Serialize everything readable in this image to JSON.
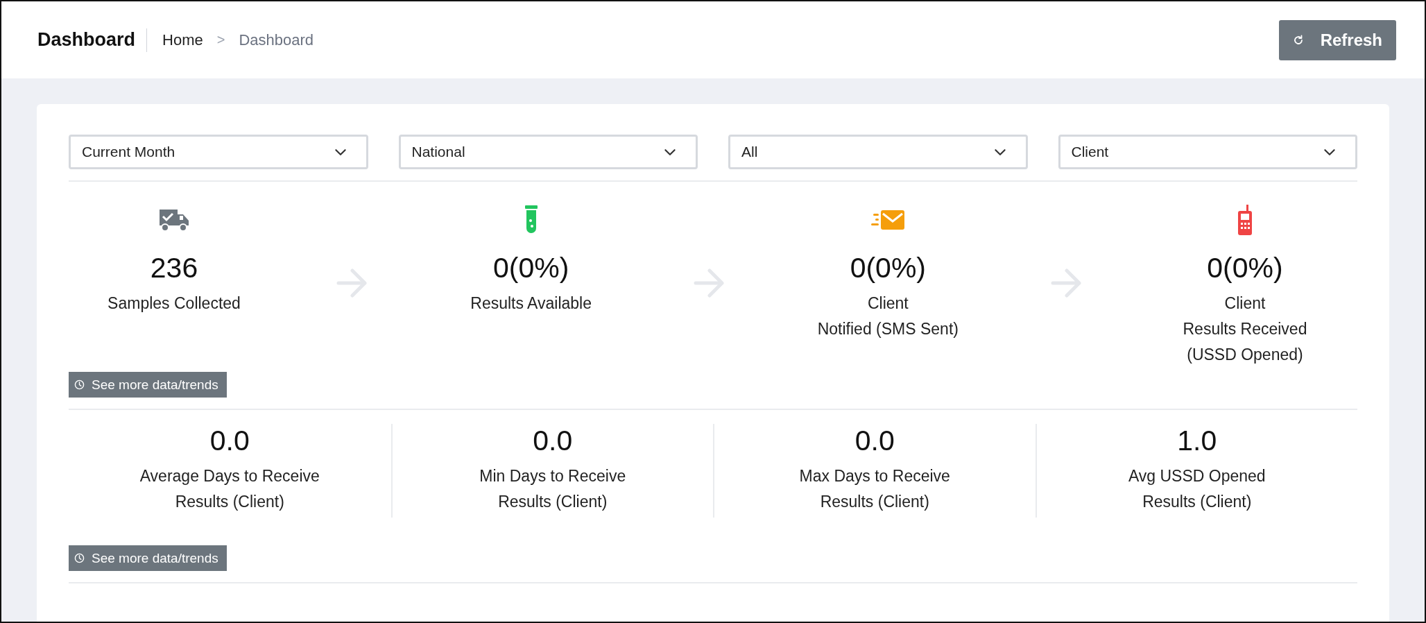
{
  "header": {
    "title": "Dashboard",
    "breadcrumb": [
      {
        "label": "Home"
      },
      {
        "label": "Dashboard"
      }
    ],
    "separator": ">",
    "refresh_button": "Refresh"
  },
  "filters": [
    {
      "value": "Current Month"
    },
    {
      "value": "National"
    },
    {
      "value": "All"
    },
    {
      "value": "Client"
    }
  ],
  "stages": [
    {
      "value": "236",
      "label": [
        "Samples Collected"
      ],
      "color": "#6c757d"
    },
    {
      "value": "0(0%)",
      "label": [
        "Results Available"
      ],
      "color": "#22c55e"
    },
    {
      "value": "0(0%)",
      "label": [
        "Client",
        "Notified (SMS Sent)"
      ],
      "color": "#f59e0b"
    },
    {
      "value": "0(0%)",
      "label": [
        "Client",
        "Results Received",
        "(USSD Opened)"
      ],
      "color": "#ef4444"
    }
  ],
  "stages_link": "See more data/trends",
  "stats": [
    {
      "value": "0.0",
      "label": [
        "Average Days to Receive",
        "Results (Client)"
      ]
    },
    {
      "value": "0.0",
      "label": [
        "Min Days to Receive",
        "Results (Client)"
      ]
    },
    {
      "value": "0.0",
      "label": [
        "Max Days to Receive",
        "Results (Client)"
      ]
    },
    {
      "value": "1.0",
      "label": [
        "Avg USSD Opened",
        "Results (Client)"
      ]
    }
  ],
  "stats_link": "See more data/trends"
}
